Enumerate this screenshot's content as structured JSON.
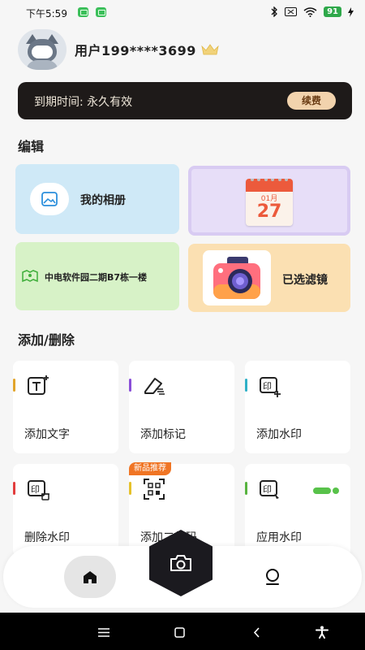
{
  "status_bar": {
    "time": "下午5:59",
    "battery": "91"
  },
  "profile": {
    "username": "用户199****3699"
  },
  "vip": {
    "expire_text": "到期时间: 永久有效",
    "renew_label": "续费"
  },
  "edit_section": {
    "title": "编辑",
    "album_label": "我的相册",
    "calendar_month": "01月",
    "calendar_day": "27",
    "location_label": "中电软件园二期B7栋一楼",
    "filter_label": "已选滤镜"
  },
  "tools_section": {
    "title": "添加/删除",
    "items": [
      {
        "label": "添加文字",
        "accent": "#e2a52c"
      },
      {
        "label": "添加标记",
        "accent": "#8a4fd8"
      },
      {
        "label": "添加水印",
        "accent": "#2fb0c7"
      },
      {
        "label": "删除水印",
        "accent": "#e23d3d"
      },
      {
        "label": "添加二维码",
        "accent": "#e6c12a",
        "badge": "新品推荐"
      },
      {
        "label": "应用水印",
        "accent": "#57b33f"
      }
    ]
  },
  "icons": [
    "home-icon",
    "camera-icon",
    "profile-icon",
    "menu-icon",
    "square-icon",
    "back-icon",
    "accessibility-icon"
  ]
}
